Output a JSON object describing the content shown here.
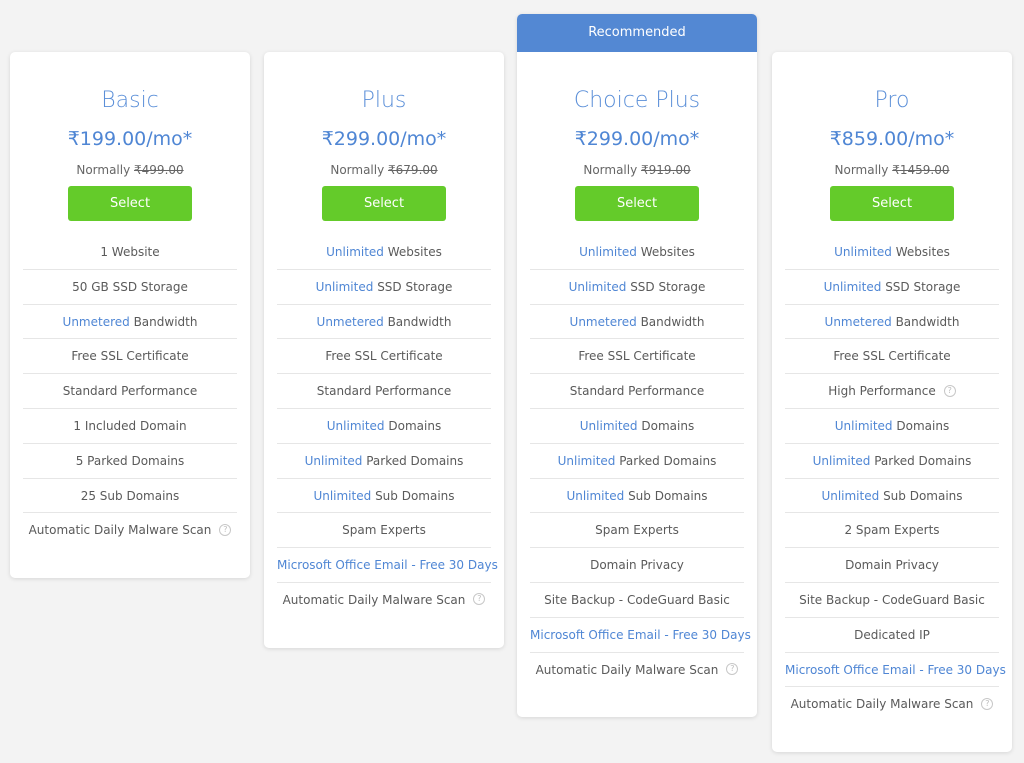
{
  "colors": {
    "accent": "#4f86d4",
    "ribbon": "#5388d3",
    "button": "#64cb2a",
    "background": "#f3f3f3"
  },
  "plans": [
    {
      "name": "Basic",
      "price": "₹199.00/mo*",
      "normally_label": "Normally",
      "normally_price": "₹499.00",
      "button_label": "Select",
      "features": [
        {
          "highlight": "",
          "text": "1 Website",
          "help": false
        },
        {
          "highlight": "",
          "text": "50 GB SSD Storage",
          "help": false
        },
        {
          "highlight": "Unmetered",
          "text": "Bandwidth",
          "help": false
        },
        {
          "highlight": "",
          "text": "Free SSL Certificate",
          "help": false
        },
        {
          "highlight": "",
          "text": "Standard Performance",
          "help": false
        },
        {
          "highlight": "",
          "text": "1 Included Domain",
          "help": false
        },
        {
          "highlight": "",
          "text": "5 Parked Domains",
          "help": false
        },
        {
          "highlight": "",
          "text": "25 Sub Domains",
          "help": false
        },
        {
          "highlight": "",
          "text": "Automatic Daily Malware Scan",
          "help": true
        }
      ]
    },
    {
      "name": "Plus",
      "price": "₹299.00/mo*",
      "normally_label": "Normally",
      "normally_price": "₹679.00",
      "button_label": "Select",
      "features": [
        {
          "highlight": "Unlimited",
          "text": "Websites",
          "help": false
        },
        {
          "highlight": "Unlimited",
          "text": "SSD Storage",
          "help": false
        },
        {
          "highlight": "Unmetered",
          "text": "Bandwidth",
          "help": false
        },
        {
          "highlight": "",
          "text": "Free SSL Certificate",
          "help": false
        },
        {
          "highlight": "",
          "text": "Standard Performance",
          "help": false
        },
        {
          "highlight": "Unlimited",
          "text": "Domains",
          "help": false
        },
        {
          "highlight": "Unlimited",
          "text": "Parked Domains",
          "help": false
        },
        {
          "highlight": "Unlimited",
          "text": "Sub Domains",
          "help": false
        },
        {
          "highlight": "",
          "text": "Spam Experts",
          "help": false
        },
        {
          "highlight": "Microsoft Office Email - Free 30 Days",
          "text": "",
          "help": false
        },
        {
          "highlight": "",
          "text": "Automatic Daily Malware Scan",
          "help": true
        }
      ]
    },
    {
      "ribbon": "Recommended",
      "name": "Choice Plus",
      "price": "₹299.00/mo*",
      "normally_label": "Normally",
      "normally_price": "₹919.00",
      "button_label": "Select",
      "features": [
        {
          "highlight": "Unlimited",
          "text": "Websites",
          "help": false
        },
        {
          "highlight": "Unlimited",
          "text": "SSD Storage",
          "help": false
        },
        {
          "highlight": "Unmetered",
          "text": "Bandwidth",
          "help": false
        },
        {
          "highlight": "",
          "text": "Free SSL Certificate",
          "help": false
        },
        {
          "highlight": "",
          "text": "Standard Performance",
          "help": false
        },
        {
          "highlight": "Unlimited",
          "text": "Domains",
          "help": false
        },
        {
          "highlight": "Unlimited",
          "text": "Parked Domains",
          "help": false
        },
        {
          "highlight": "Unlimited",
          "text": "Sub Domains",
          "help": false
        },
        {
          "highlight": "",
          "text": "Spam Experts",
          "help": false
        },
        {
          "highlight": "",
          "text": "Domain Privacy",
          "help": false
        },
        {
          "highlight": "",
          "text": "Site Backup - CodeGuard Basic",
          "help": false
        },
        {
          "highlight": "Microsoft Office Email - Free 30 Days",
          "text": "",
          "help": false
        },
        {
          "highlight": "",
          "text": "Automatic Daily Malware Scan",
          "help": true
        }
      ]
    },
    {
      "name": "Pro",
      "price": "₹859.00/mo*",
      "normally_label": "Normally",
      "normally_price": "₹1459.00",
      "button_label": "Select",
      "features": [
        {
          "highlight": "Unlimited",
          "text": "Websites",
          "help": false
        },
        {
          "highlight": "Unlimited",
          "text": "SSD Storage",
          "help": false
        },
        {
          "highlight": "Unmetered",
          "text": "Bandwidth",
          "help": false
        },
        {
          "highlight": "",
          "text": "Free SSL Certificate",
          "help": false
        },
        {
          "highlight": "",
          "text": "High Performance",
          "help": true
        },
        {
          "highlight": "Unlimited",
          "text": "Domains",
          "help": false
        },
        {
          "highlight": "Unlimited",
          "text": "Parked Domains",
          "help": false
        },
        {
          "highlight": "Unlimited",
          "text": "Sub Domains",
          "help": false
        },
        {
          "highlight": "",
          "text": "2 Spam Experts",
          "help": false
        },
        {
          "highlight": "",
          "text": "Domain Privacy",
          "help": false
        },
        {
          "highlight": "",
          "text": "Site Backup - CodeGuard Basic",
          "help": false
        },
        {
          "highlight": "",
          "text": "Dedicated IP",
          "help": false
        },
        {
          "highlight": "Microsoft Office Email - Free 30 Days",
          "text": "",
          "help": false
        },
        {
          "highlight": "",
          "text": "Automatic Daily Malware Scan",
          "help": true
        }
      ]
    }
  ],
  "help_icon_glyph": "?"
}
